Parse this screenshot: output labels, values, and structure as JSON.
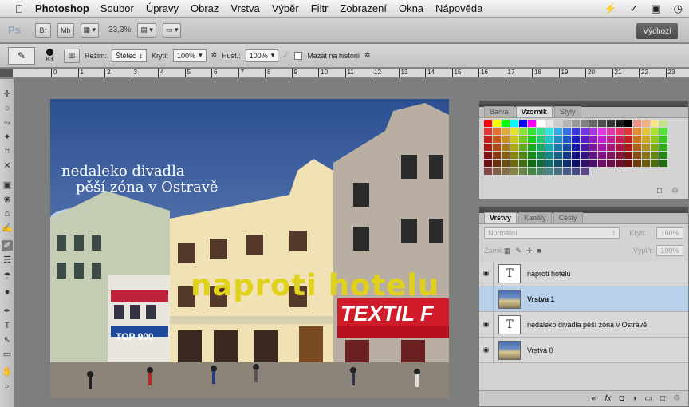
{
  "menubar": {
    "apple_icon": "apple-icon",
    "app_name": "Photoshop",
    "items": [
      "Soubor",
      "Úpravy",
      "Obraz",
      "Vrstva",
      "Výběr",
      "Filtr",
      "Zobrazení",
      "Okna",
      "Nápověda"
    ]
  },
  "appbar": {
    "logo": "Ps",
    "zoom": "33,3%",
    "workspace": "Výchozí"
  },
  "options": {
    "brush_size": "83",
    "mode_label": "Režim:",
    "mode_value": "Štětec",
    "opacity_label": "Krytí:",
    "opacity_value": "100%",
    "flow_label": "Hust.:",
    "flow_value": "100%",
    "erase_history_label": "Mazat na historii"
  },
  "ruler": {
    "labels": [
      "0",
      "1",
      "2",
      "3",
      "4",
      "5",
      "6",
      "7",
      "8",
      "9",
      "10",
      "11",
      "12",
      "13",
      "14",
      "15",
      "16",
      "17",
      "18",
      "19",
      "20",
      "21",
      "22",
      "23"
    ]
  },
  "document": {
    "text_line1": "nedaleko divadla",
    "text_line2": "pěší zóna v Ostravě",
    "text_yellow": "naproti hotelu",
    "sign_textil": "TEXTIL F",
    "sign_billa": "TOP 900"
  },
  "swatches_panel": {
    "tabs": [
      "Barva",
      "Vzorník",
      "Styly"
    ],
    "active_tab": "Vzorník"
  },
  "layers_panel": {
    "tabs": [
      "Vrstvy",
      "Kanály",
      "Cesty"
    ],
    "active_tab": "Vrstvy",
    "blend_mode": "Normální",
    "opacity_label": "Krytí:",
    "opacity_value": "100%",
    "lock_label": "Zamk:",
    "fill_label": "Výplň:",
    "fill_value": "100%",
    "layers": [
      {
        "name": "naproti hotelu",
        "type": "text",
        "visible": true,
        "selected": false
      },
      {
        "name": "Vrstva 1",
        "type": "image",
        "visible": false,
        "selected": true
      },
      {
        "name": "nedaleko divadla   pěší zóna v Ostravě",
        "type": "text",
        "visible": true,
        "selected": false
      },
      {
        "name": "Vrstva 0",
        "type": "image",
        "visible": true,
        "selected": false
      }
    ],
    "footer_icons": [
      "link-icon",
      "fx-icon",
      "mask-icon",
      "adjustment-icon",
      "folder-icon",
      "new-layer-icon",
      "trash-icon"
    ]
  }
}
